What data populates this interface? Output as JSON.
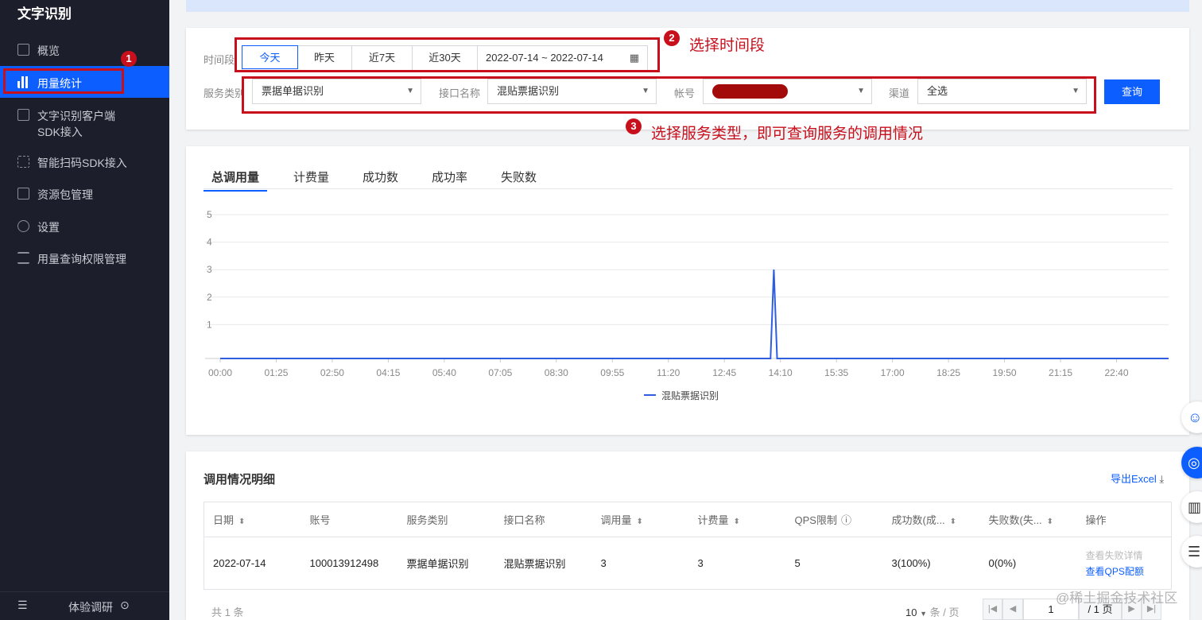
{
  "sidebar": {
    "title": "文字识别",
    "items": [
      {
        "label": "概览"
      },
      {
        "label": "用量统计"
      },
      {
        "label": "文字识别客户端",
        "label2": "SDK接入"
      },
      {
        "label": "智能扫码SDK接入"
      },
      {
        "label": "资源包管理"
      },
      {
        "label": "设置"
      },
      {
        "label": "用量查询权限管理"
      }
    ],
    "bottom": "体验调研"
  },
  "annotations": {
    "b1": "1",
    "b2": "2",
    "b3": "3",
    "a2": "选择时间段",
    "a3": "选择服务类型，即可查询服务的调用情况"
  },
  "filters": {
    "time_label": "时间段",
    "ranges": [
      "今天",
      "昨天",
      "近7天",
      "近30天"
    ],
    "date_range": "2022-07-14 ~ 2022-07-14",
    "service_label": "服务类别",
    "service": "票据单据识别",
    "api_label": "接口名称",
    "api": "混贴票据识别",
    "account_label": "帐号",
    "channel_label": "渠道",
    "channel": "全选",
    "query": "查询"
  },
  "tabs": [
    "总调用量",
    "计费量",
    "成功数",
    "成功率",
    "失败数"
  ],
  "chart_data": {
    "type": "line",
    "x_unit": "minutes",
    "xlim": [
      0,
      1439
    ],
    "ylim": [
      0,
      5
    ],
    "yticks": [
      "1",
      "2",
      "3",
      "4",
      "5"
    ],
    "xticks": [
      "00:00",
      "01:25",
      "02:50",
      "04:15",
      "05:40",
      "07:05",
      "08:30",
      "09:55",
      "11:20",
      "12:45",
      "14:10",
      "15:35",
      "17:00",
      "18:25",
      "19:50",
      "21:15",
      "22:40"
    ],
    "series": [
      {
        "name": "混贴票据识别",
        "color": "#2f5fe0",
        "points": [
          [
            0,
            0
          ],
          [
            835,
            0
          ],
          [
            840,
            3
          ],
          [
            845,
            0
          ],
          [
            1439,
            0
          ]
        ]
      }
    ]
  },
  "detail": {
    "title": "调用情况明细",
    "export": "导出Excel",
    "headers": [
      "日期",
      "账号",
      "服务类别",
      "接口名称",
      "调用量",
      "计费量",
      "QPS限制",
      "成功数(成...",
      "失败数(失...",
      "操作"
    ],
    "row": [
      "2022-07-14",
      "100013912498",
      "票据单据识别",
      "混贴票据识别",
      "3",
      "3",
      "5",
      "3(100%)",
      "0(0%)"
    ],
    "op1": "查看失败详情",
    "op2": "查看QPS配额",
    "total": "共 1 条",
    "page_size": "10",
    "per_page": "条 / 页",
    "page": "1",
    "pages": "/ 1 页"
  },
  "watermark": "@稀土掘金技术社区"
}
